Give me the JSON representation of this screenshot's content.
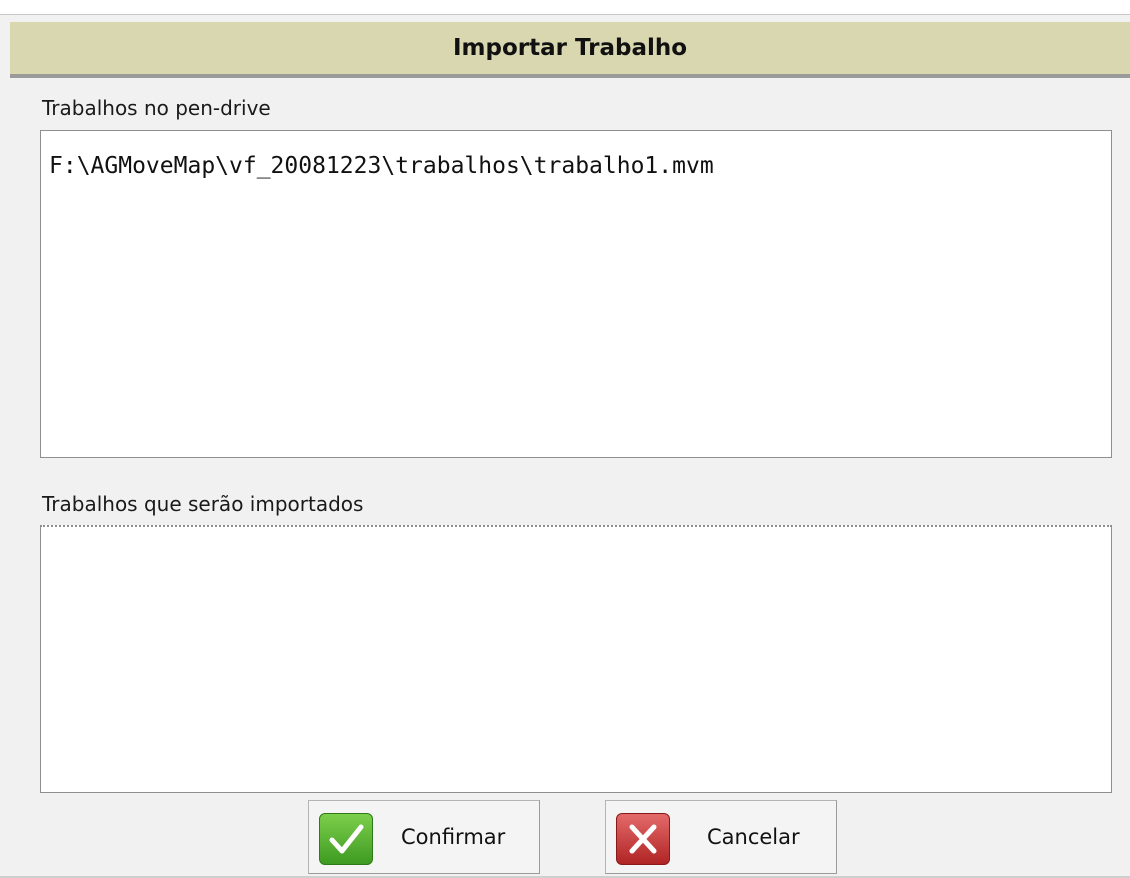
{
  "dialog": {
    "title": "Importar Trabalho"
  },
  "pendrive": {
    "label": "Trabalhos no pen-drive",
    "items": [
      "F:\\AGMoveMap\\vf_20081223\\trabalhos\\trabalho1.mvm"
    ]
  },
  "import": {
    "label": "Trabalhos que serão importados",
    "items": []
  },
  "buttons": {
    "confirm_label": "Confirmar",
    "confirm_icon": "check-icon",
    "cancel_label": "Cancelar",
    "cancel_icon": "close-icon"
  },
  "colors": {
    "title_bar": "#d9d7b0",
    "confirm_icon_bg": "#4fae2c",
    "cancel_icon_bg": "#c83434"
  }
}
